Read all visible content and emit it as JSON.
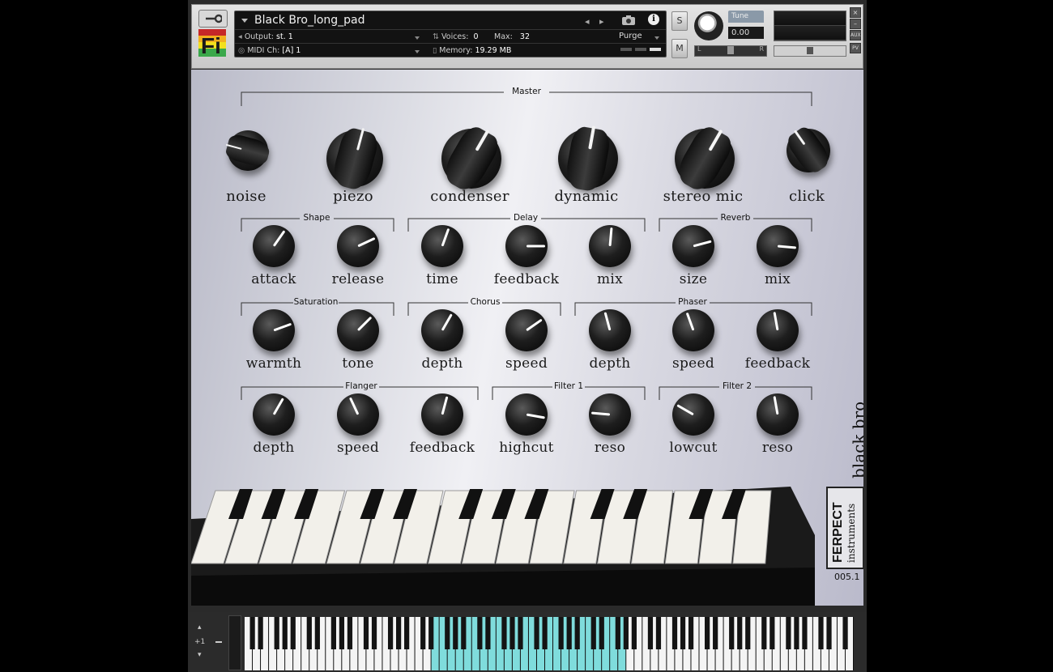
{
  "header": {
    "instrument_name": "Black Bro_long_pad",
    "output_label": "Output:",
    "output_value": "st. 1",
    "voices_label": "Voices:",
    "voices_value": "0",
    "max_label": "Max:",
    "max_value": "32",
    "purge_label": "Purge",
    "midi_label": "MIDI Ch:",
    "midi_value": "[A]  1",
    "memory_label": "Memory:",
    "memory_value": "19.29 MB",
    "solo_label": "S",
    "mute_label": "M",
    "tune_label": "Tune",
    "tune_value": "0.00",
    "pan_left": "L",
    "pan_right": "R",
    "aux_label": "AUX",
    "pv_label": "PV",
    "close_label": "×",
    "minimize_label": "–",
    "logo_text": "Fi"
  },
  "groups": {
    "master": "Master",
    "shape": "Shape",
    "delay": "Delay",
    "reverb": "Reverb",
    "saturation": "Saturation",
    "chorus": "Chorus",
    "phaser": "Phaser",
    "flanger": "Flanger",
    "filter1": "Filter 1",
    "filter2": "Filter 2"
  },
  "master_knobs": [
    {
      "label": "noise"
    },
    {
      "label": "piezo"
    },
    {
      "label": "condenser"
    },
    {
      "label": "dynamic"
    },
    {
      "label": "stereo mic"
    },
    {
      "label": "click"
    }
  ],
  "small_knobs": [
    {
      "label": "attack"
    },
    {
      "label": "release"
    },
    {
      "label": "time"
    },
    {
      "label": "feedback"
    },
    {
      "label": "mix"
    },
    {
      "label": "size"
    },
    {
      "label": "mix"
    },
    {
      "label": "warmth"
    },
    {
      "label": "tone"
    },
    {
      "label": "depth"
    },
    {
      "label": "speed"
    },
    {
      "label": "depth"
    },
    {
      "label": "speed"
    },
    {
      "label": "feedback"
    },
    {
      "label": "depth"
    },
    {
      "label": "speed"
    },
    {
      "label": "feedback"
    },
    {
      "label": "highcut"
    },
    {
      "label": "reso"
    },
    {
      "label": "lowcut"
    },
    {
      "label": "reso"
    }
  ],
  "brand": {
    "product": "black bro",
    "maker_line1": "FERPECT",
    "maker_line2": "instruments",
    "version": "005.1"
  },
  "keyboard": {
    "octave_label": "+1"
  },
  "colors": {
    "keyswitch_range": "#7fdcdc",
    "panel_light": "#f0f0f4",
    "panel_dark": "#b9bac8"
  }
}
